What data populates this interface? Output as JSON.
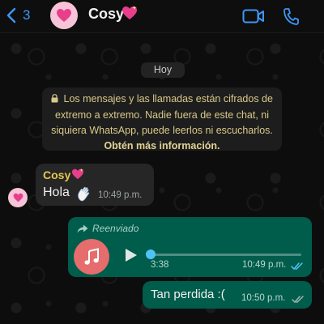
{
  "header": {
    "back_count": "3",
    "contact_name": "Cosy",
    "contact_emoji_icon": "sparkling-heart-icon",
    "video_icon": "video-camera-icon",
    "call_icon": "phone-icon"
  },
  "chat": {
    "date_chip": "Hoy",
    "encryption_notice": {
      "text": "Los mensajes y las llamadas están cifrados de extremo a extremo. Nadie fuera de este chat, ni siquiera WhatsApp, puede leerlos ni escucharlos.",
      "link": "Obtén más información."
    },
    "messages": [
      {
        "direction": "incoming",
        "sender": "Cosy",
        "text": "Hola",
        "emoji_icon": "waving-hand-icon",
        "time": "10:49 p.m."
      },
      {
        "direction": "outgoing",
        "type": "audio",
        "forwarded_label": "Reenviado",
        "duration": "3:38",
        "progress": 0,
        "time": "10:49 p.m.",
        "status": "read"
      },
      {
        "direction": "outgoing",
        "text": "Tan perdida :(",
        "time": "10:50 p.m.",
        "status": "delivered"
      }
    ]
  },
  "colors": {
    "accent": "#3e97f7",
    "outgoing_bubble": "#005c4b",
    "incoming_bubble": "#262626",
    "sender_name": "#e6c84e",
    "notice_text": "#d9c98a",
    "read_ticks": "#4fc3f7"
  }
}
